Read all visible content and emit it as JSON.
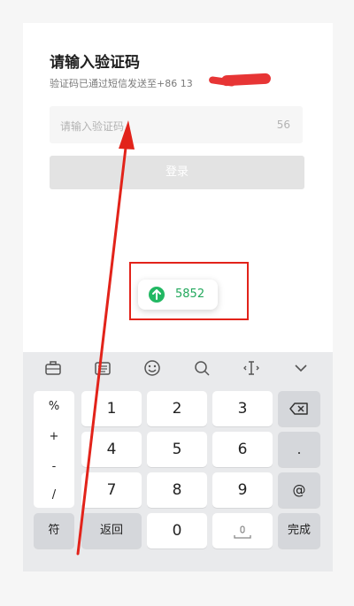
{
  "header": {
    "title": "请输入验证码",
    "subtitle": "验证码已通过短信发送至+86 13"
  },
  "code_field": {
    "placeholder": "请输入验证码",
    "countdown": "56"
  },
  "login_button": {
    "label": "登录"
  },
  "suggestion": {
    "code": "5852"
  },
  "keyboard": {
    "toolbar": [
      "toolbox-icon",
      "keyboard-layout-icon",
      "emoji-icon",
      "search-icon",
      "cursor-icon",
      "collapse-icon"
    ],
    "symbols": [
      "%",
      "+",
      "-",
      "/"
    ],
    "rows": [
      [
        "1",
        "2",
        "3"
      ],
      [
        "4",
        "5",
        "6"
      ],
      [
        "7",
        "8",
        "9"
      ]
    ],
    "backspace_icon": "backspace-icon",
    "dot": ".",
    "at": "@",
    "fu": "符",
    "back": "返回",
    "zero": "0",
    "space_icon": "microphone-icon",
    "done": "完成"
  },
  "colors": {
    "accent_green": "#22b863",
    "annotation_red": "#e2231a"
  }
}
